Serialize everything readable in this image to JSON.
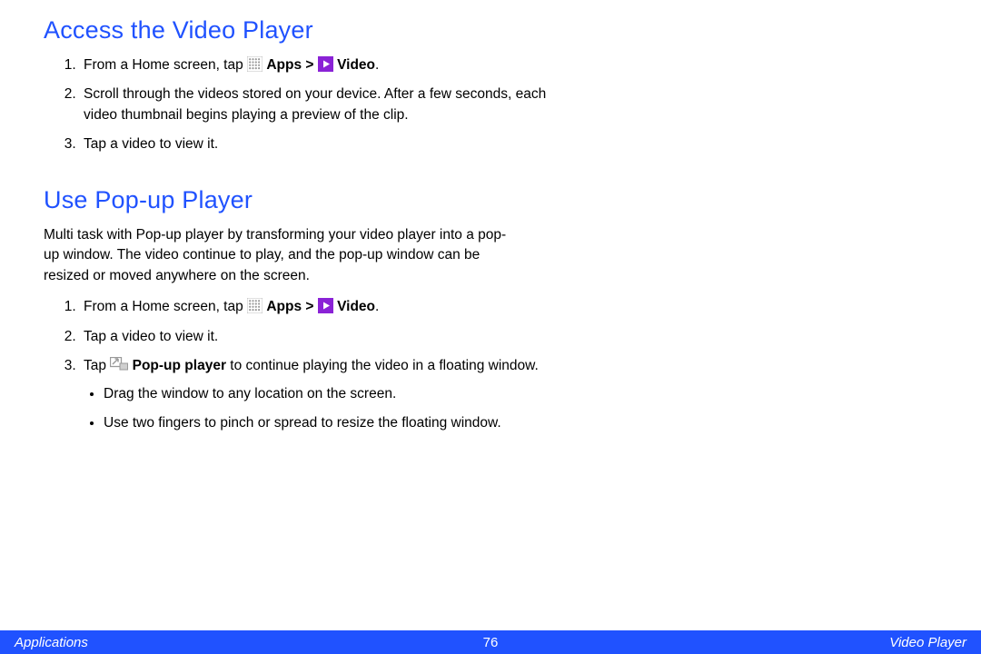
{
  "section1": {
    "heading": "Access the Video Player",
    "step1_pre": "From a Home screen, tap ",
    "apps_label": "Apps",
    "gt": " > ",
    "video_label": "Video",
    "step1_post": ".",
    "step2": "Scroll through the videos stored on your device. After a few seconds, each video thumbnail begins playing a preview of the clip.",
    "step3": "Tap a video to view it."
  },
  "section2": {
    "heading": "Use Pop-up Player",
    "intro": "Multi task with Pop-up player by transforming your video player into a pop-up window. The video continue to play, and the pop-up window can be resized or moved anywhere on the screen.",
    "step1_pre": "From a Home screen, tap ",
    "apps_label": "Apps",
    "gt": " > ",
    "video_label": "Video",
    "step1_post": ".",
    "step2": "Tap a video to view it.",
    "step3_pre": "Tap ",
    "popup_label": "Pop-up player",
    "step3_post": " to continue playing the video in a floating window.",
    "bullet1": "Drag the window to any location on the screen.",
    "bullet2": "Use two fingers to pinch or spread to resize the floating window."
  },
  "footer": {
    "left": "Applications",
    "center": "76",
    "right": "Video Player"
  }
}
